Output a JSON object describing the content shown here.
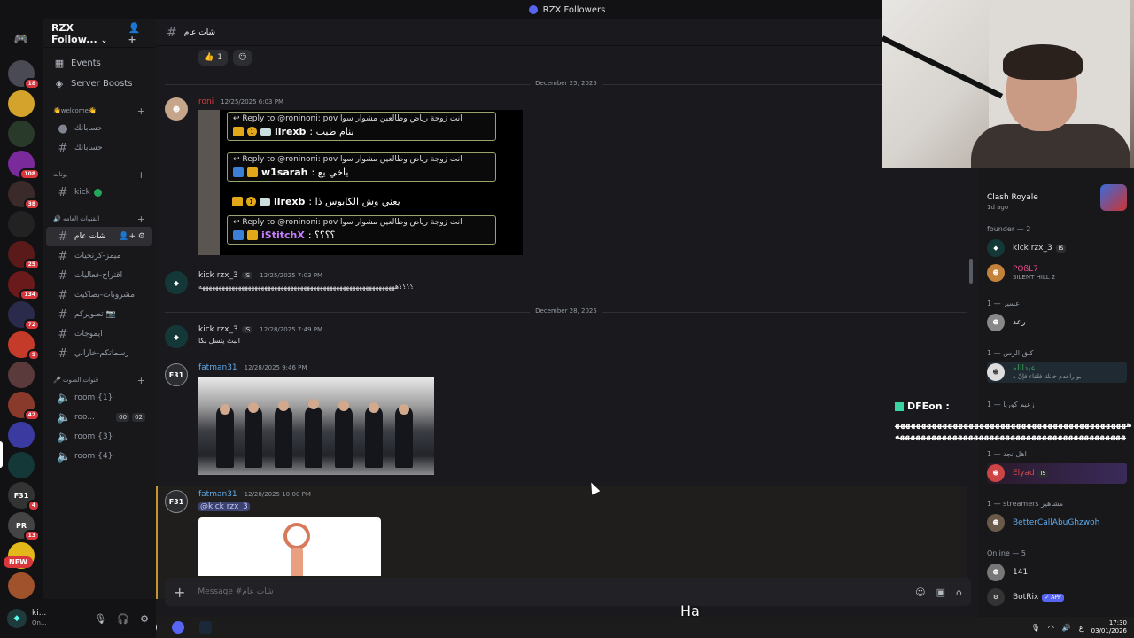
{
  "window": {
    "title": "RZX Followers"
  },
  "server": {
    "name": "RZX Follow...",
    "new_label": "NEW"
  },
  "rail_badges": [
    "18",
    "108",
    "38",
    "25",
    "134",
    "72",
    "9",
    "42",
    "4",
    "13"
  ],
  "rail_labels": [
    "F31",
    "PR"
  ],
  "nav": {
    "events": "Events",
    "boosts": "Server Boosts"
  },
  "categories": {
    "welcome": "👋welcome👋",
    "bots": "بوتات",
    "general": "🔊 القنوات العامه",
    "voice": "🎤 قنوات الصوت"
  },
  "channels": {
    "c1": "حسابانك",
    "c2": "حسابانك",
    "kick": "kick",
    "chat": "شات عام",
    "memes": "ميمز-كرنجيات",
    "suggest": "اقتراح-فعاليات",
    "projects": "مشروبات-بصاكيت",
    "photos": "تصويركم 📷",
    "emojis": "ايموجات",
    "drawings": "رسماتكم-خاراني"
  },
  "voice": {
    "r1": "room {1}",
    "r2": "roo...",
    "r2_a": "00",
    "r2_b": "02",
    "r3": "room {3}",
    "r4": "room {4}"
  },
  "user": {
    "name": "ki...",
    "status": "On..."
  },
  "chat": {
    "channel": "شات عام",
    "reaction_count": "1",
    "date1": "December 25, 2025",
    "date2": "December 28, 2025",
    "m1_author": "roni",
    "m1_time": "12/25/2025 6:03 PM",
    "replies": [
      {
        "r": "↩ Reply to @roninoni: pov انت زوجة رياض وطالعين مشوار سوا",
        "name": "llrexb",
        "text": ": بنام طيب"
      },
      {
        "r": "↩ Reply to @roninoni: pov انت زوجة رياض وطالعين مشوار سوا",
        "name": "w1sarah",
        "text": ": ياخي يع"
      },
      {
        "r": "",
        "name": "llrexb",
        "text": ": يعني وش الكابوس ذا"
      },
      {
        "r": "↩ Reply to @roninoni: pov انت زوجة رياض وطالعين مشوار سوا",
        "name": "iStitchX",
        "text": ": ؟؟؟؟"
      }
    ],
    "m2_author": "kick rzx_3",
    "m2_tag": "IS",
    "m2_time": "12/25/2025 7:03 PM",
    "m2_text": "؟؟؟؟ههههههههههههههههههههههههههههههههههههههههههههههههههههههههههههه",
    "m3_author": "kick rzx_3",
    "m3_tag": "IS",
    "m3_time": "12/28/2025 7:49 PM",
    "m3_text": "البث يتسل بكا",
    "m4_author": "fatman31",
    "m4_time": "12/28/2025 9:46 PM",
    "m5_author": "fatman31",
    "m5_time": "12/28/2025 10:00 PM",
    "m5_mention": "@kick rzx_3",
    "avatar_f31": "F31",
    "compose_placeholder": "Message #شات عام"
  },
  "members": {
    "activity_title": "Clash Royale",
    "activity_time": "1d ago",
    "cat_founder": "founder — 2",
    "f1": "kick rzx_3",
    "f1_tag": "IS",
    "f2": "POßL7",
    "f2_sub": "SILENT HILL 2",
    "cat_g1": "1 — عسير",
    "g1": "رعد",
    "cat_g2": "1 — كنق الرس",
    "g2": "عبدالله",
    "g2_sub": "بو راعدم خانك فلقاء فإنّ ه",
    "cat_g3": "1 — زعيم كوريا",
    "cat_g4": "1 — اهل نجد",
    "g4": "Elyad",
    "g4_tag": "IS",
    "cat_streamers": "1 — streamers مشاهير",
    "s1": "BetterCallAbuGhzwoh",
    "cat_online": "Online — 5",
    "o1": "141",
    "o2": "BotRix",
    "o2_badge": "✓ APP"
  },
  "overlay": {
    "name": "DFEon :",
    "text": "ههههههههههههههههههههههههههههههههههههههههههههههههههههههههههههههههههههههههههههههههههههههههه"
  },
  "subtitle": "Ha",
  "taskbar": {
    "time": "17:30",
    "date": "03/01/2026",
    "lang": "ع"
  },
  "colors": {
    "accent": "#5865f2",
    "online": "#23a55a",
    "highlight": "#c49633",
    "mention_bg": "#3c4270"
  }
}
